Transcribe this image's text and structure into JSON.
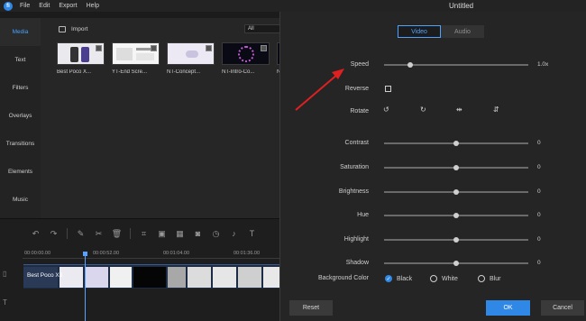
{
  "app": {
    "logo": "fi",
    "menu": [
      "File",
      "Edit",
      "Export",
      "Help"
    ],
    "window_title": "Untitled"
  },
  "sidebar": {
    "items": [
      {
        "label": "Media",
        "active": true
      },
      {
        "label": "Text",
        "active": false
      },
      {
        "label": "Filters",
        "active": false
      },
      {
        "label": "Overlays",
        "active": false
      },
      {
        "label": "Transitions",
        "active": false
      },
      {
        "label": "Elements",
        "active": false
      },
      {
        "label": "Music",
        "active": false
      }
    ]
  },
  "media": {
    "import_label": "Import",
    "filter_value": "All",
    "thumbnails": [
      {
        "label": "Best Poco X..."
      },
      {
        "label": "YT-End Scre..."
      },
      {
        "label": "NT-Concept..."
      },
      {
        "label": "NT-Intro-Co..."
      },
      {
        "label": "N"
      }
    ]
  },
  "timeline": {
    "timecodes": [
      "00:00:00.00",
      "00:00:52.00",
      "00:01:04.00",
      "00:01:36.00"
    ],
    "clip_label": "Best Poco X3"
  },
  "properties": {
    "tabs": [
      {
        "label": "Video",
        "active": true
      },
      {
        "label": "Audio",
        "active": false
      }
    ],
    "speed": {
      "label": "Speed",
      "value": "1.0x",
      "fraction": 0.18
    },
    "reverse": {
      "label": "Reverse",
      "checked": false
    },
    "rotate": {
      "label": "Rotate"
    },
    "sliders": [
      {
        "label": "Contrast",
        "value": "0",
        "fraction": 0.5
      },
      {
        "label": "Saturation",
        "value": "0",
        "fraction": 0.5
      },
      {
        "label": "Brightness",
        "value": "0",
        "fraction": 0.5
      },
      {
        "label": "Hue",
        "value": "0",
        "fraction": 0.5
      },
      {
        "label": "Highlight",
        "value": "0",
        "fraction": 0.5
      },
      {
        "label": "Shadow",
        "value": "0",
        "fraction": 0.5
      }
    ],
    "background": {
      "label": "Background Color",
      "options": [
        {
          "label": "Black",
          "checked": true
        },
        {
          "label": "White",
          "checked": false
        },
        {
          "label": "Blur",
          "checked": false
        }
      ]
    },
    "buttons": {
      "reset": "Reset",
      "ok": "OK",
      "cancel": "Cancel"
    }
  },
  "colors": {
    "accent": "#2f87e6",
    "annotation_arrow": "#e02020"
  }
}
